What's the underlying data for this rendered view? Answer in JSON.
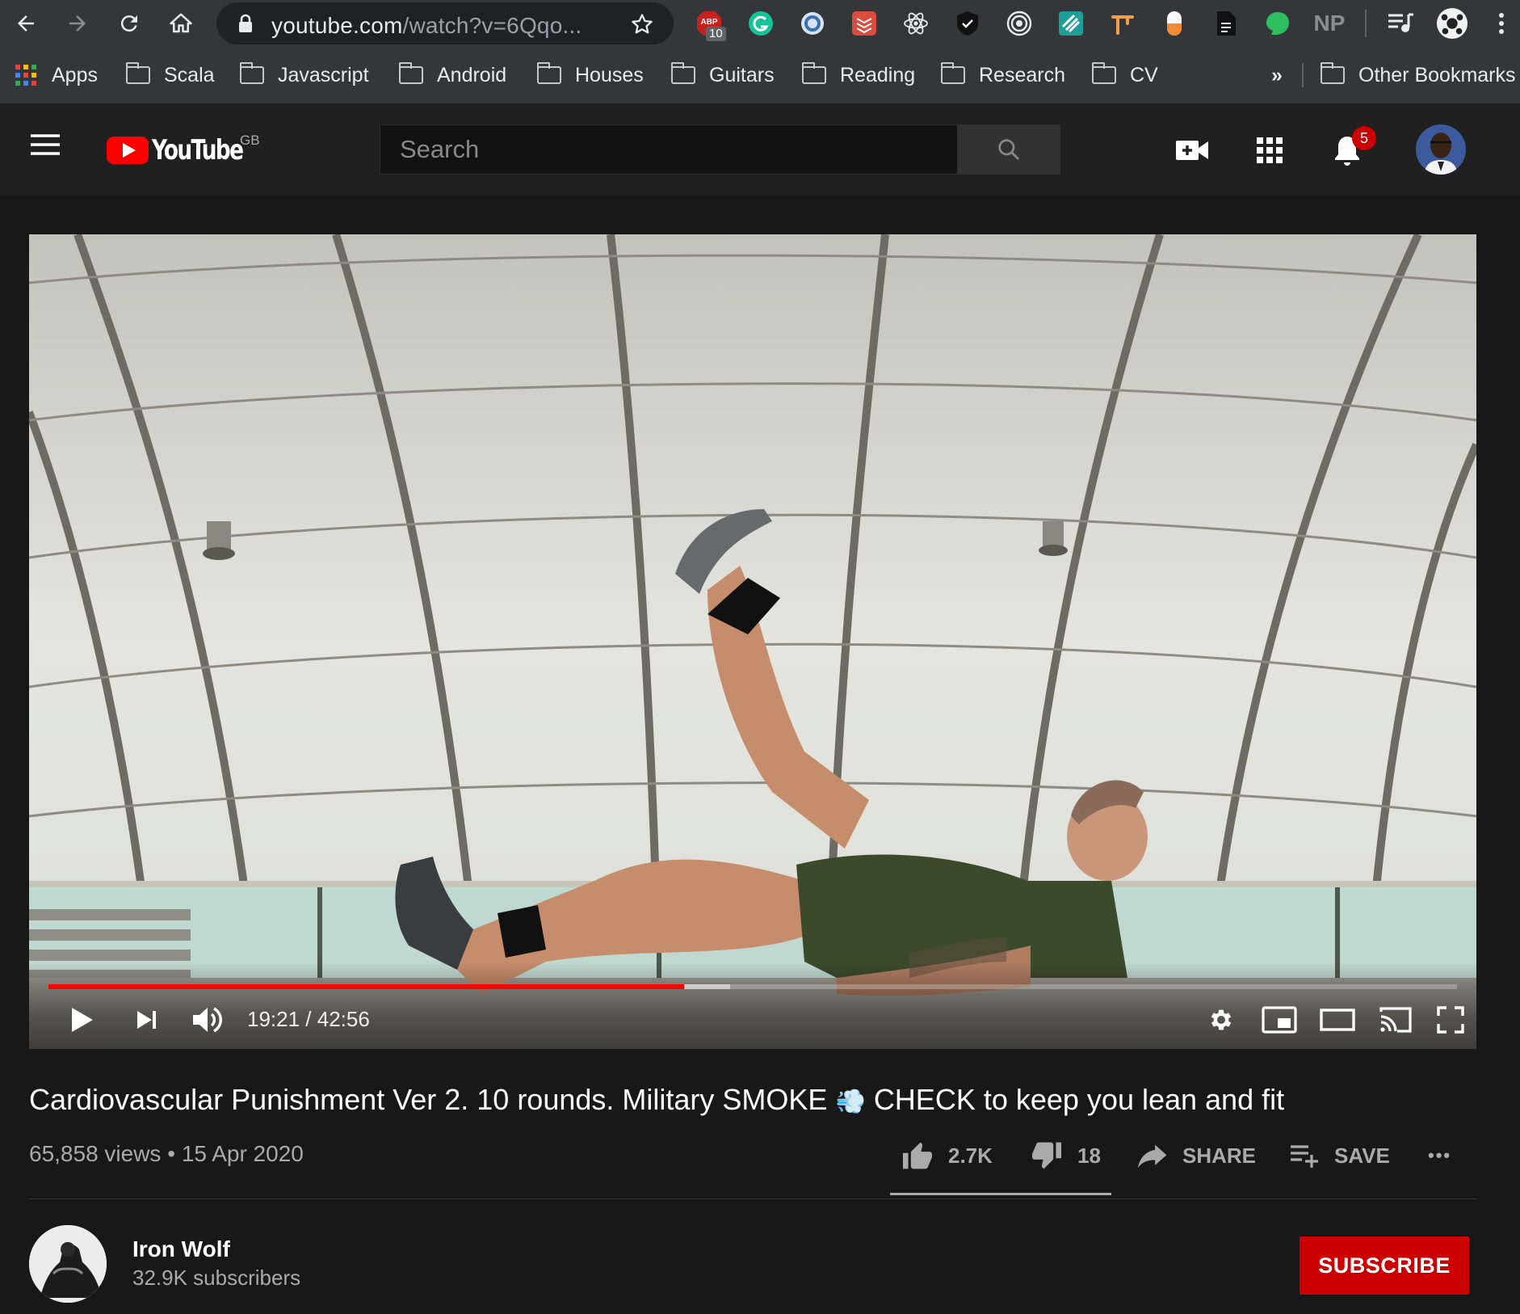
{
  "browser": {
    "url_host": "youtube.com",
    "url_path": "/watch?v=6Qqo...",
    "extensions": {
      "abp_badge": "10",
      "np_label": "NP"
    },
    "bookmarks": {
      "apps": "Apps",
      "items": [
        {
          "label": "Scala"
        },
        {
          "label": "Javascript"
        },
        {
          "label": "Android"
        },
        {
          "label": "Houses"
        },
        {
          "label": "Guitars"
        },
        {
          "label": "Reading"
        },
        {
          "label": "Research"
        },
        {
          "label": "CV"
        }
      ],
      "overflow": "»",
      "other": "Other Bookmarks"
    }
  },
  "masthead": {
    "logo_text": "YouTube",
    "country": "GB",
    "search_placeholder": "Search",
    "notification_count": "5"
  },
  "player": {
    "current_time": "19:21",
    "duration": "42:56",
    "time_display": "19:21 / 42:56",
    "played_fraction": 0.451,
    "buffered_fraction": 0.484
  },
  "video": {
    "title_part1": "Cardiovascular Punishment Ver 2. 10 rounds. Military SMOKE",
    "title_emoji": "💨",
    "title_part2": "CHECK to keep you lean and fit",
    "views": "65,858 views",
    "separator": "•",
    "date": "15 Apr 2020",
    "likes": "2.7K",
    "dislikes": "18",
    "share_label": "SHARE",
    "save_label": "SAVE",
    "more_label": "•••",
    "like_fraction": 0.993
  },
  "channel": {
    "name": "Iron Wolf",
    "subscribers": "32.9K subscribers",
    "subscribe_label": "SUBSCRIBE"
  },
  "colors": {
    "brand_red": "#ff0000",
    "subscribe_red": "#cc0000",
    "background": "#181818",
    "masthead": "#202020",
    "chrome": "#35363a"
  }
}
